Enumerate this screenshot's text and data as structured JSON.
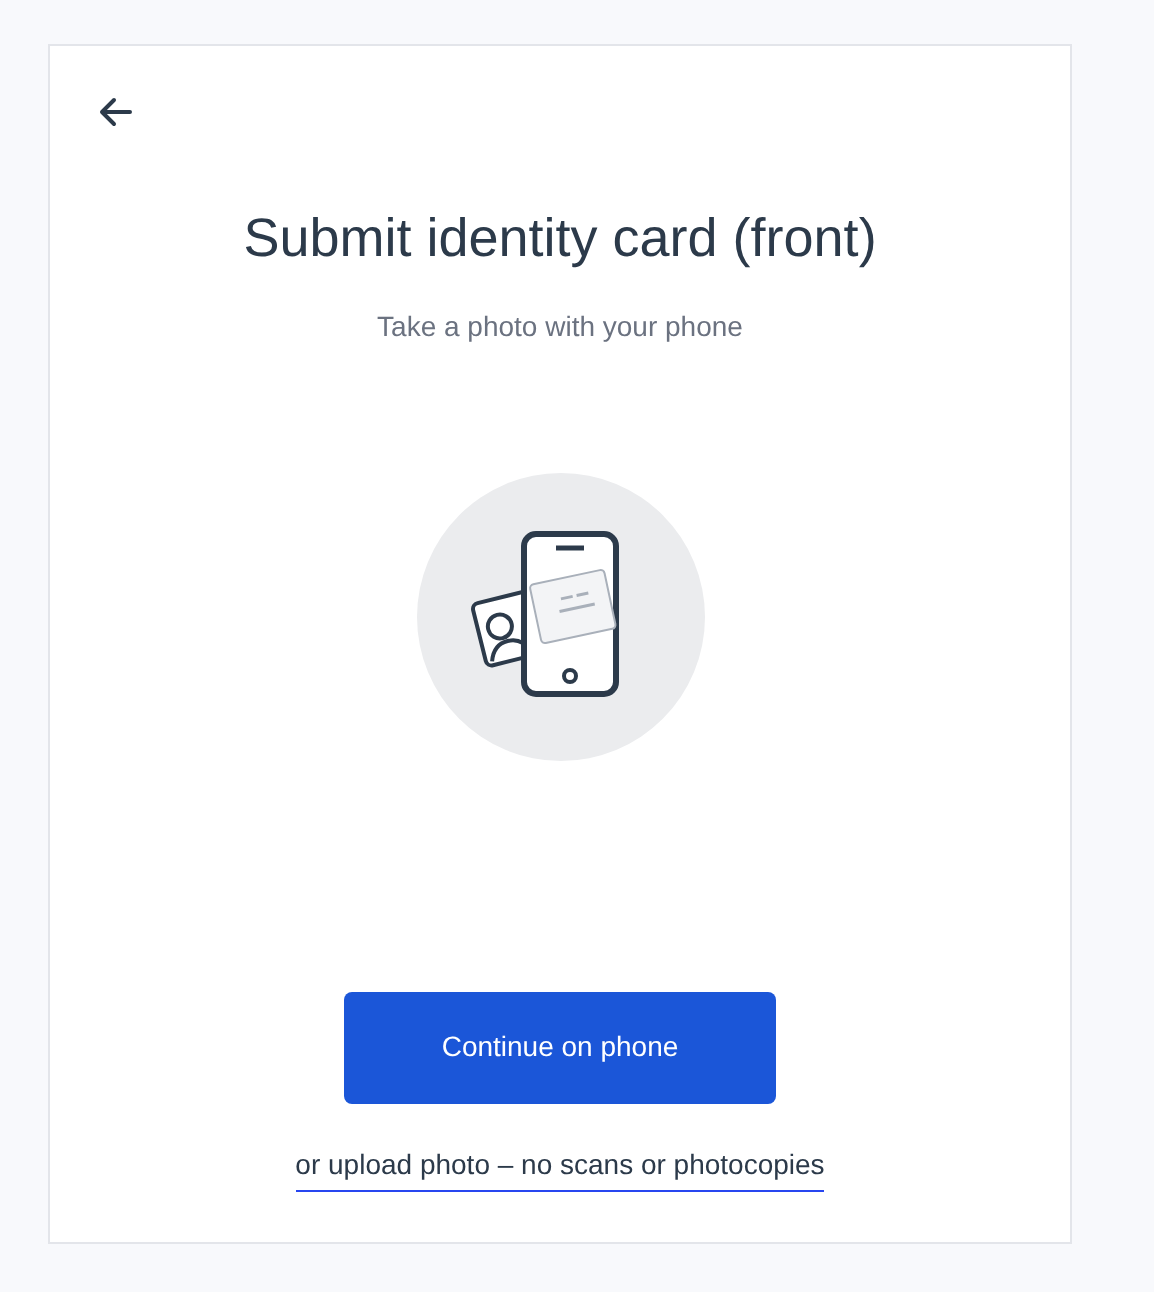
{
  "title": "Submit identity card (front)",
  "subtitle": "Take a photo with your phone",
  "primary_button": "Continue on phone",
  "upload_link": "or upload photo – no scans or photocopies"
}
